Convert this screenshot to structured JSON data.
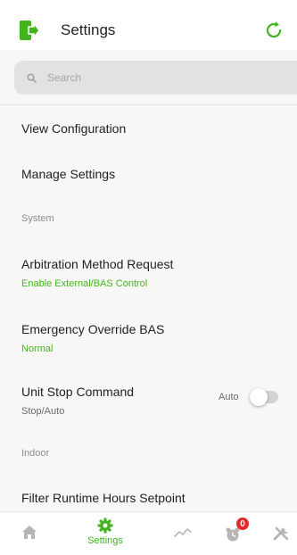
{
  "header": {
    "title": "Settings",
    "exit_icon": "exit-door-icon",
    "refresh_icon": "refresh-icon"
  },
  "search": {
    "placeholder": "Search",
    "value": "",
    "icon": "search-icon"
  },
  "menu": {
    "view_configuration": "View Configuration",
    "manage_settings": "Manage Settings"
  },
  "sections": {
    "system": "System",
    "indoor": "Indoor"
  },
  "settings": {
    "arbitration": {
      "label": "Arbitration Method Request",
      "value": "Enable External/BAS Control"
    },
    "emergency": {
      "label": "Emergency Override BAS",
      "value": "Normal"
    },
    "unit_stop": {
      "label": "Unit Stop Command",
      "value": "Stop/Auto",
      "toggle_label": "Auto",
      "toggle_on": false
    },
    "filter_runtime": {
      "label": "Filter Runtime Hours Setpoint"
    }
  },
  "nav": {
    "home_icon": "home-icon",
    "settings_label": "Settings",
    "settings_icon": "gear-icon",
    "trends_icon": "trend-line-icon",
    "alarms_icon": "alarm-clock-icon",
    "alarm_count": "0",
    "service_icon": "tools-icon"
  },
  "colors": {
    "accent": "#44b320",
    "badge": "#e8262b",
    "content_bg": "#f7f7f6"
  }
}
